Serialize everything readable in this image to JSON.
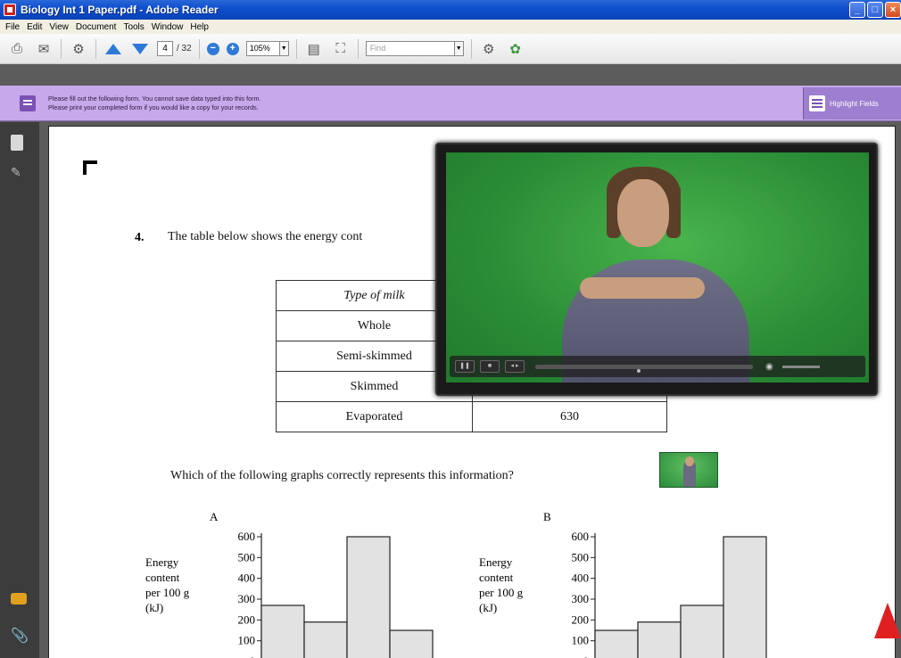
{
  "window": {
    "title": "Biology Int 1 Paper.pdf - Adobe Reader",
    "buttons": [
      "_",
      "□",
      "×"
    ]
  },
  "menu": [
    "File",
    "Edit",
    "View",
    "Document",
    "Tools",
    "Window",
    "Help"
  ],
  "toolbar": {
    "page_current": "4",
    "page_total": "/ 32",
    "zoom": "105%",
    "find_placeholder": "Find",
    "icons": [
      "print-icon",
      "mail-icon",
      "collaborate-icon",
      "prev-page-icon",
      "next-page-icon",
      "zoom-out-icon",
      "zoom-in-icon",
      "fit-page-icon",
      "full-screen-icon",
      "search-icon",
      "sign-icon"
    ]
  },
  "formbar": {
    "line1": "Please fill out the following form. You cannot save data typed into this form.",
    "line2": "Please print your completed form if you would like a copy for your records.",
    "highlight_label": "Highlight Fields"
  },
  "document": {
    "question_number": "4.",
    "question_text": "The table below shows the energy cont",
    "table_header": "Type of milk",
    "table_rows": [
      {
        "milk": "Whole",
        "energy": ""
      },
      {
        "milk": "Semi-skimmed",
        "energy": ""
      },
      {
        "milk": "Skimmed",
        "energy": ""
      },
      {
        "milk": "Evaporated",
        "energy": "630"
      }
    ],
    "which_text": "Which of the following graphs correctly represents this information?",
    "graph_ylabel": [
      "Energy",
      "content",
      "per 100 g",
      "(kJ)"
    ],
    "graph_ticks": [
      "600",
      "500",
      "400",
      "300",
      "200",
      "100",
      "0"
    ]
  },
  "chart_data": [
    {
      "type": "bar",
      "title": "A",
      "ylabel": "Energy content per 100 g (kJ)",
      "ylim": [
        0,
        600
      ],
      "values": [
        270,
        190,
        630,
        150
      ]
    },
    {
      "type": "bar",
      "title": "B",
      "ylabel": "Energy content per 100 g (kJ)",
      "ylim": [
        0,
        600
      ],
      "values": [
        150,
        190,
        270,
        630
      ]
    }
  ],
  "video_controls": [
    "play-pause-icon",
    "stop-icon",
    "rewind-icon",
    "volume-icon"
  ]
}
